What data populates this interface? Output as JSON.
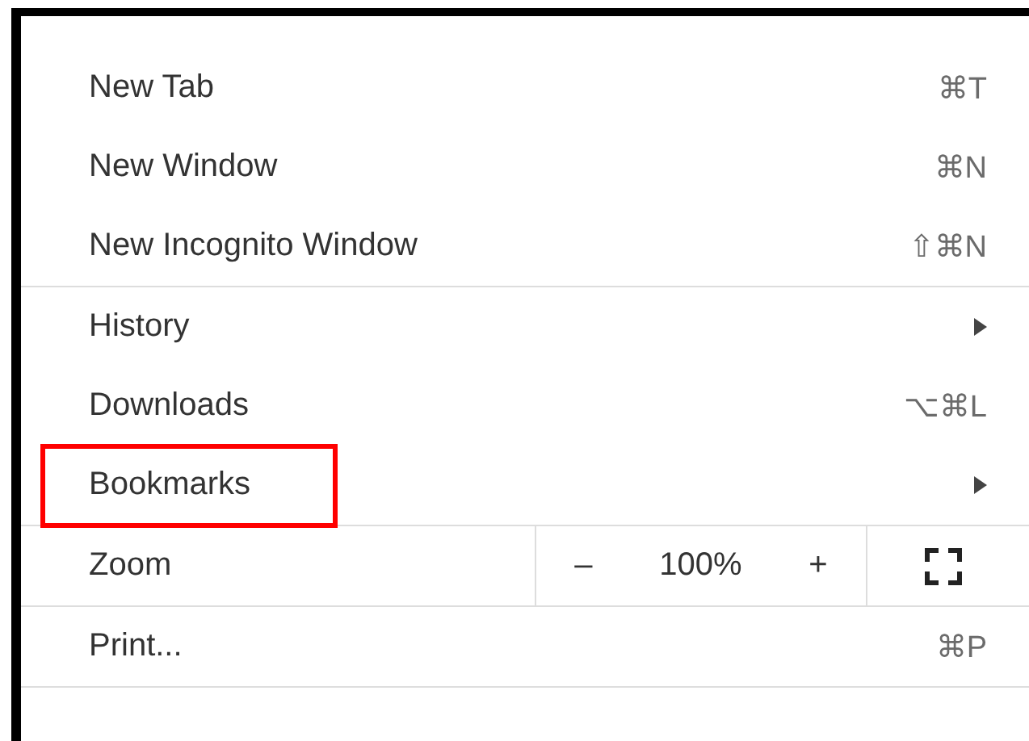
{
  "menu": {
    "sections": [
      {
        "items": [
          {
            "kind": "shortcut",
            "label": "New Tab",
            "shortcut": "⌘T",
            "highlighted": false
          },
          {
            "kind": "shortcut",
            "label": "New Window",
            "shortcut": "⌘N",
            "highlighted": false
          },
          {
            "kind": "shortcut",
            "label": "New Incognito Window",
            "shortcut": "⇧⌘N",
            "highlighted": false
          }
        ]
      },
      {
        "items": [
          {
            "kind": "submenu",
            "label": "History",
            "highlighted": false
          },
          {
            "kind": "shortcut",
            "label": "Downloads",
            "shortcut": "⌥⌘L",
            "highlighted": false
          },
          {
            "kind": "submenu",
            "label": "Bookmarks",
            "highlighted": true
          }
        ]
      },
      {
        "items": [
          {
            "kind": "zoom",
            "label": "Zoom",
            "decrease": "–",
            "value": "100%",
            "increase": "+"
          }
        ]
      },
      {
        "items": [
          {
            "kind": "shortcut",
            "label": "Print...",
            "shortcut": "⌘P",
            "highlighted": false
          }
        ]
      }
    ]
  }
}
